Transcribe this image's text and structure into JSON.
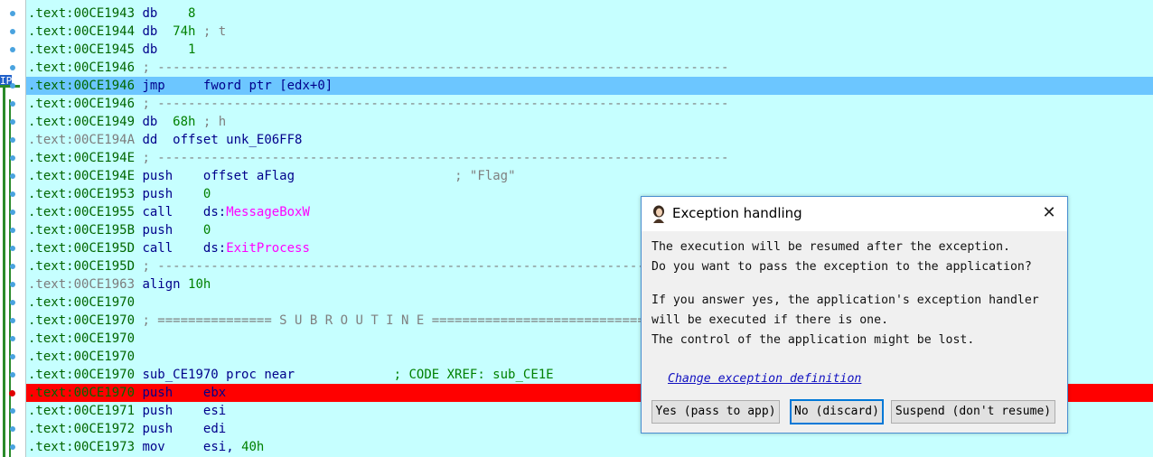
{
  "listing": [
    {
      "addr": ".text:00CE1943",
      "mn": "db",
      "op": "8",
      "opclass": "num",
      "comment": "",
      "style": ""
    },
    {
      "addr": ".text:00CE1944",
      "mn": "db",
      "op": "74h",
      "opclass": "num",
      "comment": "; t",
      "style": ""
    },
    {
      "addr": ".text:00CE1945",
      "mn": "db",
      "op": "1",
      "opclass": "num",
      "comment": "",
      "style": ""
    },
    {
      "addr": ".text:00CE1946",
      "sep": "; ---------------------------------------------------------------------------",
      "style": ""
    },
    {
      "addr": ".text:00CE1946",
      "mn": "jmp",
      "op": "fword ptr [edx+0]",
      "opclass": "op",
      "comment": "",
      "style": "hl-blue"
    },
    {
      "addr": ".text:00CE1946",
      "sep": "; ---------------------------------------------------------------------------",
      "style": ""
    },
    {
      "addr": ".text:00CE1949",
      "mn": "db",
      "op": "68h",
      "opclass": "num",
      "comment": "; h",
      "style": ""
    },
    {
      "addr": ".text:00CE194A",
      "mn": "dd",
      "op": "offset unk_E06FF8",
      "opclass": "op",
      "comment": "",
      "style": "",
      "gray": true
    },
    {
      "addr": ".text:00CE194E",
      "sep": "; ---------------------------------------------------------------------------",
      "style": ""
    },
    {
      "addr": ".text:00CE194E",
      "mn": "push",
      "op": "offset aFlag",
      "opclass": "op",
      "comment": "; \"Flag\"",
      "style": ""
    },
    {
      "addr": ".text:00CE1953",
      "mn": "push",
      "op": "0",
      "opclass": "num",
      "comment": "",
      "style": ""
    },
    {
      "addr": ".text:00CE1955",
      "mn": "call",
      "op": "ds:",
      "ext": "MessageBoxW",
      "opclass": "op",
      "comment": "",
      "style": ""
    },
    {
      "addr": ".text:00CE195B",
      "mn": "push",
      "op": "0",
      "opclass": "num",
      "comment": "",
      "style": ""
    },
    {
      "addr": ".text:00CE195D",
      "mn": "call",
      "op": "ds:",
      "ext": "ExitProcess",
      "opclass": "op",
      "comment": "",
      "style": ""
    },
    {
      "addr": ".text:00CE195D",
      "sep": "; ---------------------------------------------------------------------------",
      "style": ""
    },
    {
      "addr": ".text:00CE1963",
      "mn": "align",
      "op": "10h",
      "opclass": "num",
      "comment": "",
      "style": "",
      "gray": true
    },
    {
      "addr": ".text:00CE1970",
      "style": ""
    },
    {
      "addr": ".text:00CE1970",
      "sep": "; =============== S U B R O U T I N E =======================================",
      "style": ""
    },
    {
      "addr": ".text:00CE1970",
      "style": ""
    },
    {
      "addr": ".text:00CE1970",
      "style": ""
    },
    {
      "addr": ".text:00CE1970",
      "label": "sub_CE1970 proc near",
      "comment": "; CODE XREF: sub_CE1E",
      "style": ""
    },
    {
      "addr": ".text:00CE1970",
      "mn": "push",
      "op": "ebx",
      "opclass": "op",
      "comment": "",
      "style": "hl-red"
    },
    {
      "addr": ".text:00CE1971",
      "mn": "push",
      "op": "esi",
      "opclass": "op",
      "comment": "",
      "style": ""
    },
    {
      "addr": ".text:00CE1972",
      "mn": "push",
      "op": "edi",
      "opclass": "op",
      "comment": "",
      "style": ""
    },
    {
      "addr": ".text:00CE1973",
      "mn": "mov",
      "op": "esi, ",
      "num": "40h",
      "opclass": "op",
      "comment": "",
      "style": ""
    }
  ],
  "ip_marker": "IP",
  "dialog": {
    "title": "Exception handling",
    "close_label": "✕",
    "lines": [
      "The execution will be resumed after the exception.",
      "Do you want to pass the exception to the application?",
      "If you answer yes, the application's exception handler",
      "will be executed if there is one.",
      "The control of the application might be lost."
    ],
    "link": "Change exception definition",
    "buttons": {
      "yes": "Yes (pass to app)",
      "no": "No (discard)",
      "suspend": "Suspend (don't resume)"
    }
  },
  "colors": {
    "listing_bg": "#c6ffff",
    "current_line": "#6cc6ff",
    "breakpoint_line": "#ff0000",
    "dialog_border": "#4a8fd1"
  }
}
